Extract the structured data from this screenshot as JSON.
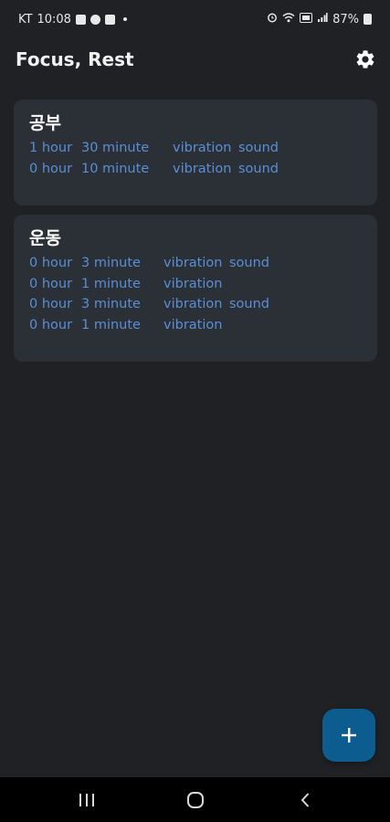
{
  "status_bar": {
    "carrier": "KT",
    "time": "10:08",
    "battery": "87%",
    "icons_left": [
      "gallery-icon",
      "chat-icon",
      "calendar-icon"
    ],
    "icons_right": [
      "alarm-icon",
      "wifi-icon",
      "volte-icon",
      "signal-icon",
      "battery-icon"
    ]
  },
  "header": {
    "title": "Focus, Rest",
    "settings_icon": "gear-icon"
  },
  "routines": [
    {
      "name": "공부",
      "entries": [
        {
          "hours": "1 hour",
          "minutes": "30 minute",
          "vibration": "vibration",
          "sound": "sound"
        },
        {
          "hours": "0 hour",
          "minutes": "10 minute",
          "vibration": "vibration",
          "sound": "sound"
        }
      ]
    },
    {
      "name": "운동",
      "entries": [
        {
          "hours": "0 hour",
          "minutes": "3 minute",
          "vibration": "vibration",
          "sound": "sound"
        },
        {
          "hours": "0 hour",
          "minutes": "1 minute",
          "vibration": "vibration",
          "sound": ""
        },
        {
          "hours": "0 hour",
          "minutes": "3 minute",
          "vibration": "vibration",
          "sound": "sound"
        },
        {
          "hours": "0 hour",
          "minutes": "1 minute",
          "vibration": "vibration",
          "sound": ""
        }
      ]
    }
  ],
  "fab": {
    "icon": "plus-icon"
  },
  "nav_bar": {
    "icons": [
      "recents-icon",
      "home-icon",
      "back-icon"
    ]
  },
  "colors": {
    "background": "#1f2124",
    "card": "#2a3036",
    "entry_text": "#5b8ed6",
    "fab": "#0d5c8f"
  }
}
